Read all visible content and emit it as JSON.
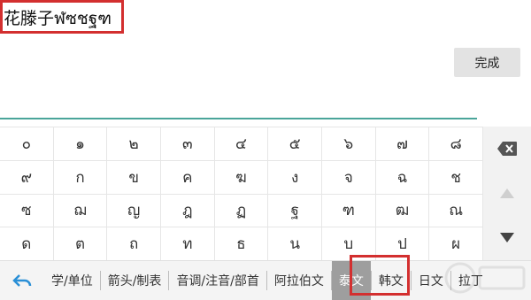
{
  "input": {
    "text": "花滕子ฬซชฐฑ"
  },
  "toolbar": {
    "done_label": "完成"
  },
  "keys": [
    [
      "๐",
      "๑",
      "๒",
      "๓",
      "๔",
      "๕",
      "๖",
      "๗",
      "๘"
    ],
    [
      "๙",
      "ก",
      "ข",
      "ค",
      "ฆ",
      "ง",
      "จ",
      "ฉ",
      "ช"
    ],
    [
      "ซ",
      "ฌ",
      "ญ",
      "ฎ",
      "ฏ",
      "ฐ",
      "ฑ",
      "ฒ",
      "ณ"
    ],
    [
      "ด",
      "ต",
      "ถ",
      "ท",
      "ธ",
      "น",
      "บ",
      "ป",
      "ผ"
    ]
  ],
  "side_icons": [
    "backspace-icon",
    "arrow-up-icon",
    "arrow-down-icon"
  ],
  "categories": [
    "学/单位",
    "箭头/制表",
    "音调/注音/部首",
    "阿拉伯文",
    "泰文",
    "韩文",
    "日文",
    "拉丁"
  ],
  "active_category": "泰文",
  "colors": {
    "accent_underline": "#4aa59a",
    "highlight_frame": "#d32f2f",
    "active_tab": "#9e9e9e",
    "back_arrow": "#2a8fd6"
  }
}
